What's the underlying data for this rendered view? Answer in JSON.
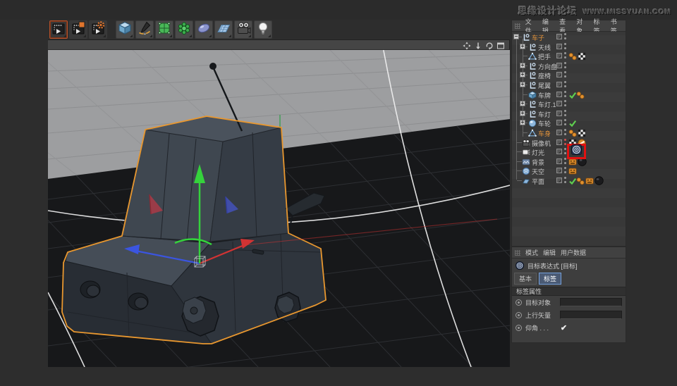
{
  "watermark": {
    "brand": "思缘设计论坛",
    "url": "WWW.MISSYUAN.COM"
  },
  "toolbar": {
    "icons": [
      "render-view-icon",
      "render-picture-viewer-icon",
      "render-settings-icon",
      "add-cube-icon",
      "freehand-spline-icon",
      "subdivision-surface-icon",
      "modeling-generator-icon",
      "metaball-icon",
      "floor-icon",
      "camera-icon",
      "light-icon"
    ]
  },
  "viewport": {
    "nav_icons": [
      "pan-icon",
      "dolly-icon",
      "rotate-icon",
      "maximize-view-icon"
    ]
  },
  "object_manager": {
    "menu": [
      "文件",
      "编辑",
      "查看",
      "对象",
      "标签",
      "书签"
    ],
    "objects": [
      {
        "name": "车子",
        "icon": "null",
        "level": 0,
        "expander": "minus",
        "selected": true,
        "tags": []
      },
      {
        "name": "天线",
        "icon": "null",
        "level": 1,
        "expander": "plus",
        "tags": []
      },
      {
        "name": "把手",
        "icon": "polygon",
        "level": 1,
        "expander": "leaf",
        "tags": [
          "balls",
          "uvw"
        ]
      },
      {
        "name": "方向盘",
        "icon": "null",
        "level": 1,
        "expander": "plus",
        "tags": []
      },
      {
        "name": "座椅",
        "icon": "null",
        "level": 1,
        "expander": "plus",
        "tags": []
      },
      {
        "name": "尾翼",
        "icon": "null",
        "level": 1,
        "expander": "plus",
        "tags": []
      },
      {
        "name": "车牌",
        "icon": "cube",
        "level": 1,
        "expander": "leaf",
        "enabled": true,
        "tags": [
          "balls"
        ]
      },
      {
        "name": "车灯.1",
        "icon": "null",
        "level": 1,
        "expander": "plus",
        "tags": []
      },
      {
        "name": "车灯",
        "icon": "null",
        "level": 1,
        "expander": "plus",
        "tags": []
      },
      {
        "name": "车轮",
        "icon": "sphere",
        "level": 1,
        "expander": "plus",
        "enabled": true,
        "tags": []
      },
      {
        "name": "车身",
        "icon": "polygon",
        "level": 1,
        "expander": "leaf",
        "selected": true,
        "tags": [
          "balls",
          "uvw"
        ]
      },
      {
        "name": "摄像机",
        "icon": "camera",
        "level": 0,
        "expander": "leaf",
        "dots": "red",
        "tags": [
          "uvw",
          "protection"
        ]
      },
      {
        "name": "灯光",
        "icon": "light",
        "level": 0,
        "expander": "leaf",
        "highlight": true,
        "tags": [
          "target"
        ]
      },
      {
        "name": "背景",
        "icon": "background",
        "level": 0,
        "expander": "leaf",
        "tags": [
          "compositing",
          "material"
        ]
      },
      {
        "name": "天空",
        "icon": "sky",
        "level": 0,
        "expander": "leaf",
        "tags": [
          "compositing"
        ]
      },
      {
        "name": "平面",
        "icon": "plane",
        "level": 0,
        "expander": "leaf",
        "enabled": true,
        "tags": [
          "balls",
          "compositing",
          "material"
        ]
      }
    ]
  },
  "attribute_manager": {
    "menu": [
      "模式",
      "编辑",
      "用户数据"
    ],
    "title": "目标表达式 [目标]",
    "title_icon": "target-expression-icon",
    "tabs": [
      {
        "label": "基本",
        "active": false
      },
      {
        "label": "标签",
        "active": true
      }
    ],
    "section": "标签属性",
    "fields": [
      {
        "label": "目标对象",
        "type": "input",
        "value": ""
      },
      {
        "label": "上行矢量",
        "type": "input",
        "value": ""
      },
      {
        "label": "仰角 . . .",
        "type": "checkbox",
        "checked": true
      }
    ]
  },
  "colors": {
    "selection_outline": "#e8972f",
    "axis_x": "#d23333",
    "axis_y": "#35d23c",
    "axis_z": "#3b55e0",
    "annotation_box": "#e01212",
    "tab_active_border": "#74a0dc",
    "enabled_check": "#5fcf4f",
    "tag_orange": "#d8882a",
    "viewport_sky": "#9d9ea0",
    "viewport_floor": "#17181a"
  }
}
